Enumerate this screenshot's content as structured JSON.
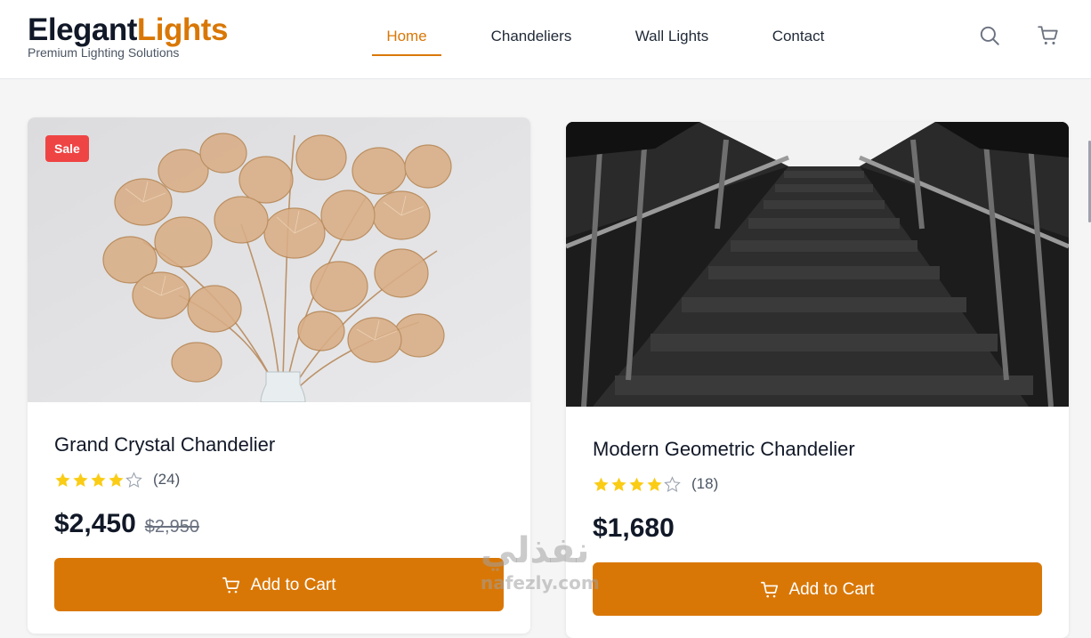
{
  "header": {
    "logo_main": "Elegant",
    "logo_accent": "Lights",
    "tagline": "Premium Lighting Solutions",
    "nav": [
      {
        "label": "Home",
        "active": true
      },
      {
        "label": "Chandeliers",
        "active": false
      },
      {
        "label": "Wall Lights",
        "active": false
      },
      {
        "label": "Contact",
        "active": false
      }
    ],
    "icons": [
      "search-icon",
      "cart-icon"
    ]
  },
  "products": [
    {
      "title": "Grand Crystal Chandelier",
      "badge": "Sale",
      "rating": 4,
      "review_count": "(24)",
      "price": "$2,450",
      "old_price": "$2,950",
      "button_label": "Add to Cart",
      "image": "gold-leaf-branches-in-vase"
    },
    {
      "title": "Modern Geometric Chandelier",
      "rating": 4,
      "review_count": "(18)",
      "price": "$1,680",
      "button_label": "Add to Cart",
      "image": "black-white-staircase"
    }
  ],
  "watermark": {
    "arabic": "نفذلي",
    "latin": "nafezly.com"
  },
  "colors": {
    "accent": "#d97706",
    "sale": "#ef4444",
    "star": "#facc15",
    "text": "#111827"
  }
}
